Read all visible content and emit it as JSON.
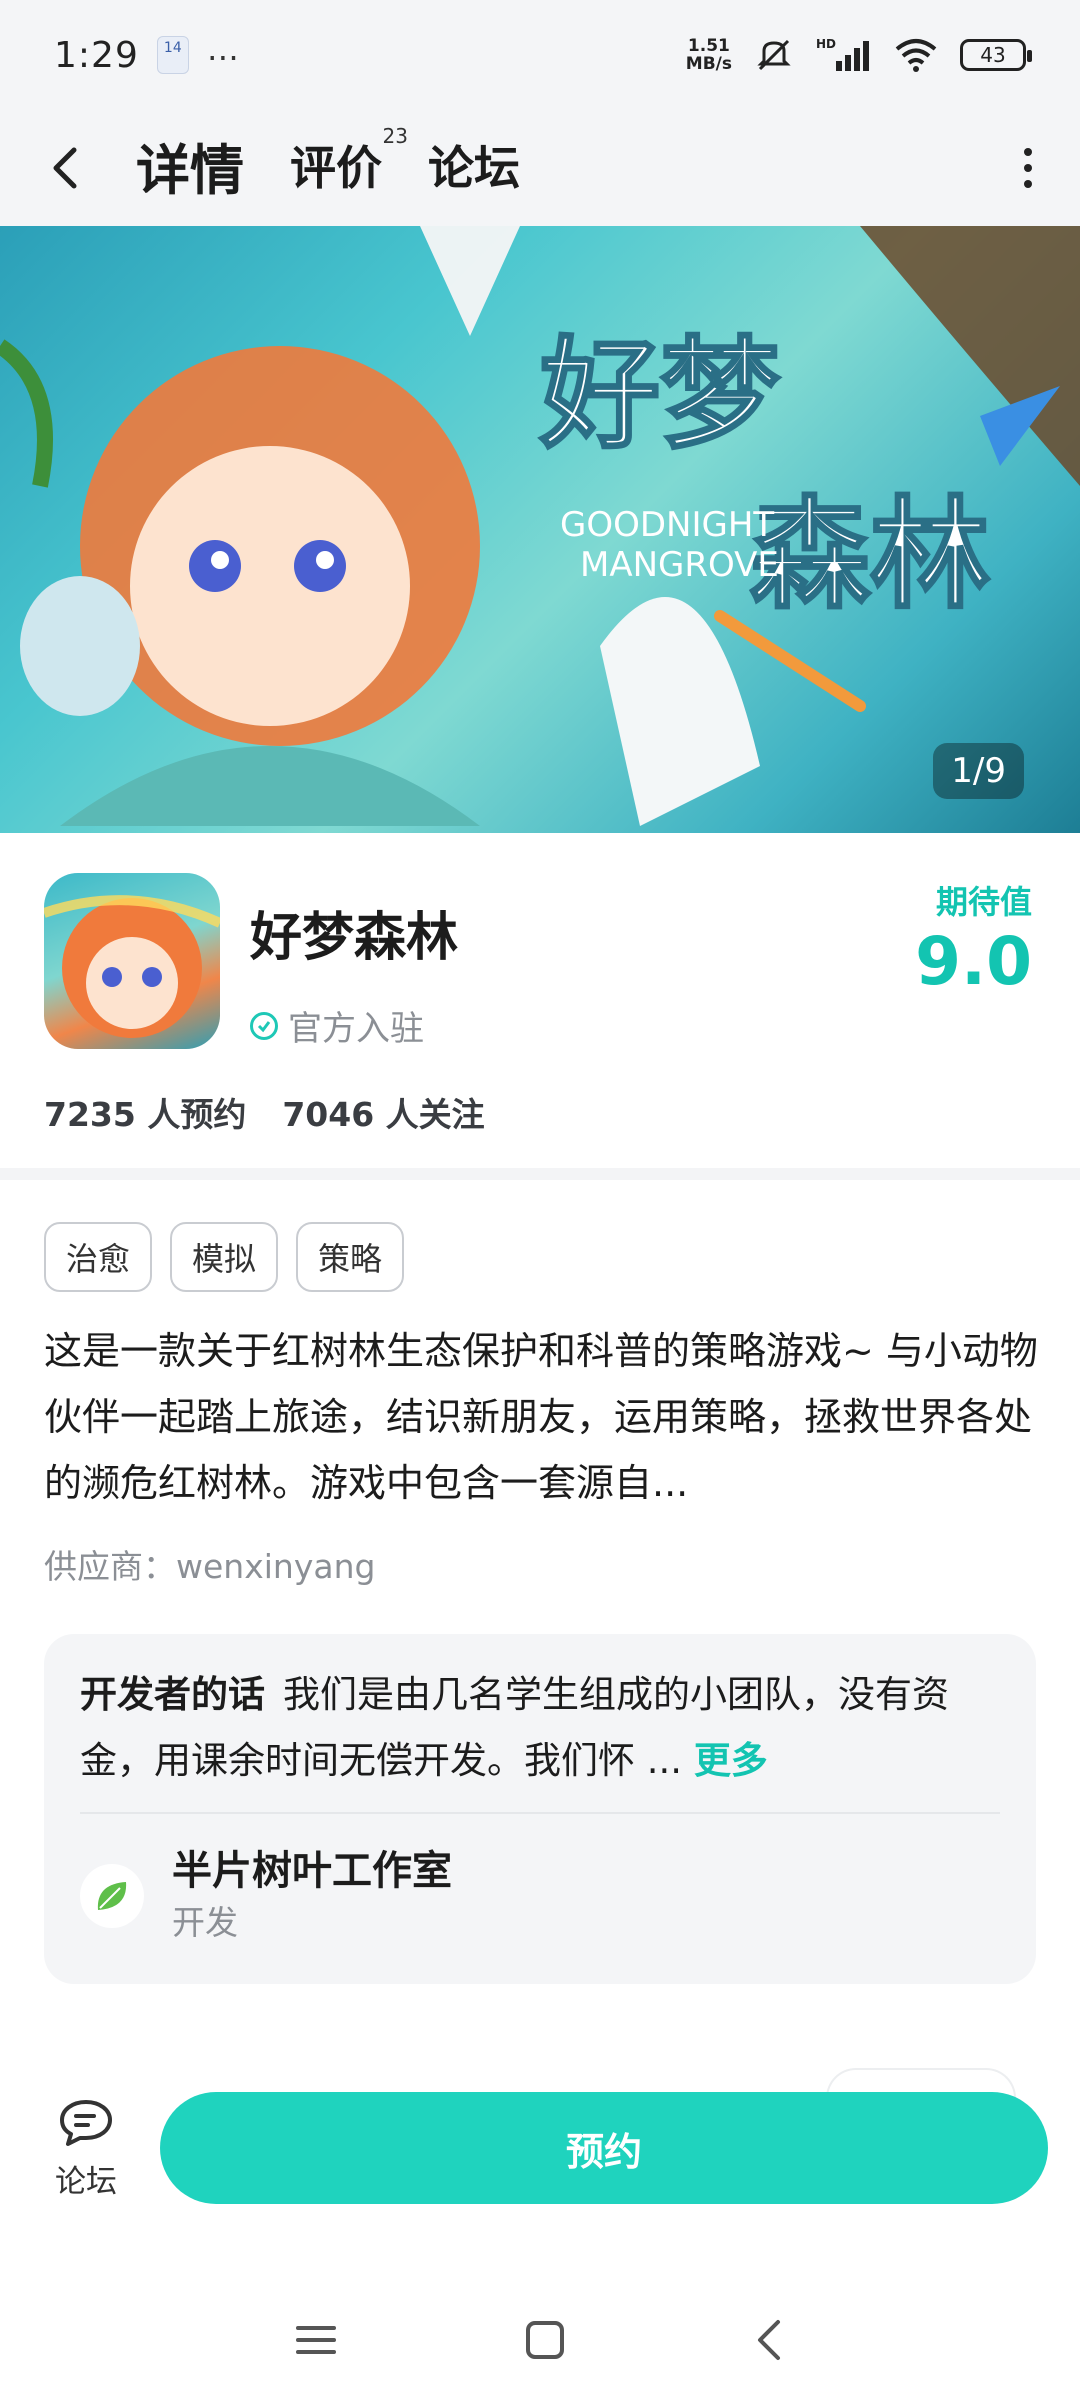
{
  "status_bar": {
    "time": "1:29",
    "calendar_badge": "14",
    "net_speed_value": "1.51",
    "net_speed_unit": "MB/s",
    "signal_label": "HD",
    "battery": "43"
  },
  "nav": {
    "tabs": [
      {
        "label": "详情",
        "active": true
      },
      {
        "label": "评价",
        "count": "23"
      },
      {
        "label": "论坛"
      }
    ]
  },
  "banner": {
    "counter": "1/9"
  },
  "app": {
    "name": "好梦森林",
    "official_label": "官方入驻",
    "expect_label": "期待值",
    "expect_score": "9.0",
    "reservations": "7235 人预约",
    "followers": "7046 人关注"
  },
  "tags": [
    "治愈",
    "模拟",
    "策略"
  ],
  "description": "这是一款关于红树林生态保护和科普的策略游戏~ 与小动物伙伴一起踏上旅途，结识新朋友，运用策略，拯救世界各处的濒危红树林。游戏中包含一套源自...",
  "supplier": "供应商：wenxinyang",
  "developer": {
    "label": "开发者的话",
    "words": "我们是由几名学生组成的小团队，没有资金，用课余时间无偿开发。我们怀 ...",
    "more": "更多",
    "studio_name": "半片树叶工作室",
    "studio_role": "开发"
  },
  "bottom": {
    "forum_label": "论坛",
    "reserve_label": "预约"
  },
  "colors": {
    "accent": "#1fd3be",
    "score": "#13c4b1"
  }
}
